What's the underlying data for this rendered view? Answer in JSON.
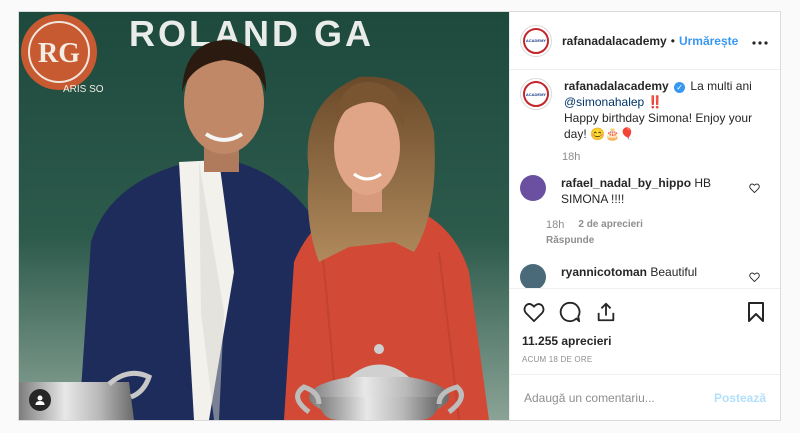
{
  "photo": {
    "backdrop_text": "ROLAND GA",
    "logo_text": "RG",
    "logo_ring_text": "ARIS SO"
  },
  "post": {
    "author": "rafanadalacademy",
    "separator": "•",
    "follow_label": "Urmărește",
    "avatar_label": "ACADEMY",
    "caption": {
      "author": "rafanadalacademy",
      "text_before_mention": "La multi ani",
      "mention": "@simonahalep",
      "exclaim": "‼️",
      "line2": "Happy birthday Simona! Enjoy your day! 😊🎂🎈",
      "time": "18h"
    },
    "comments": [
      {
        "user": "rafael_nadal_by_hippo",
        "text": "HB SIMONA !!!!",
        "time": "18h",
        "likes": "2 de aprecieri",
        "reply_label": "Răspunde",
        "avatar_color": "#6b4fa0"
      },
      {
        "user": "ryannicotoman",
        "text": "Beautiful",
        "avatar_color": "#4a6a7a"
      }
    ],
    "likes_count": "11.255 aprecieri",
    "time_ago": "ACUM 18 DE ORE",
    "comment_placeholder": "Adaugă un comentariu...",
    "post_button": "Postează"
  },
  "colors": {
    "link": "#3897f0",
    "post_button_disabled": "#b2dffc",
    "muted": "#8e8e8e"
  },
  "icons": [
    "heart-icon",
    "comment-icon",
    "share-icon",
    "bookmark-icon",
    "more-icon",
    "verified-icon",
    "user-tag-icon"
  ]
}
